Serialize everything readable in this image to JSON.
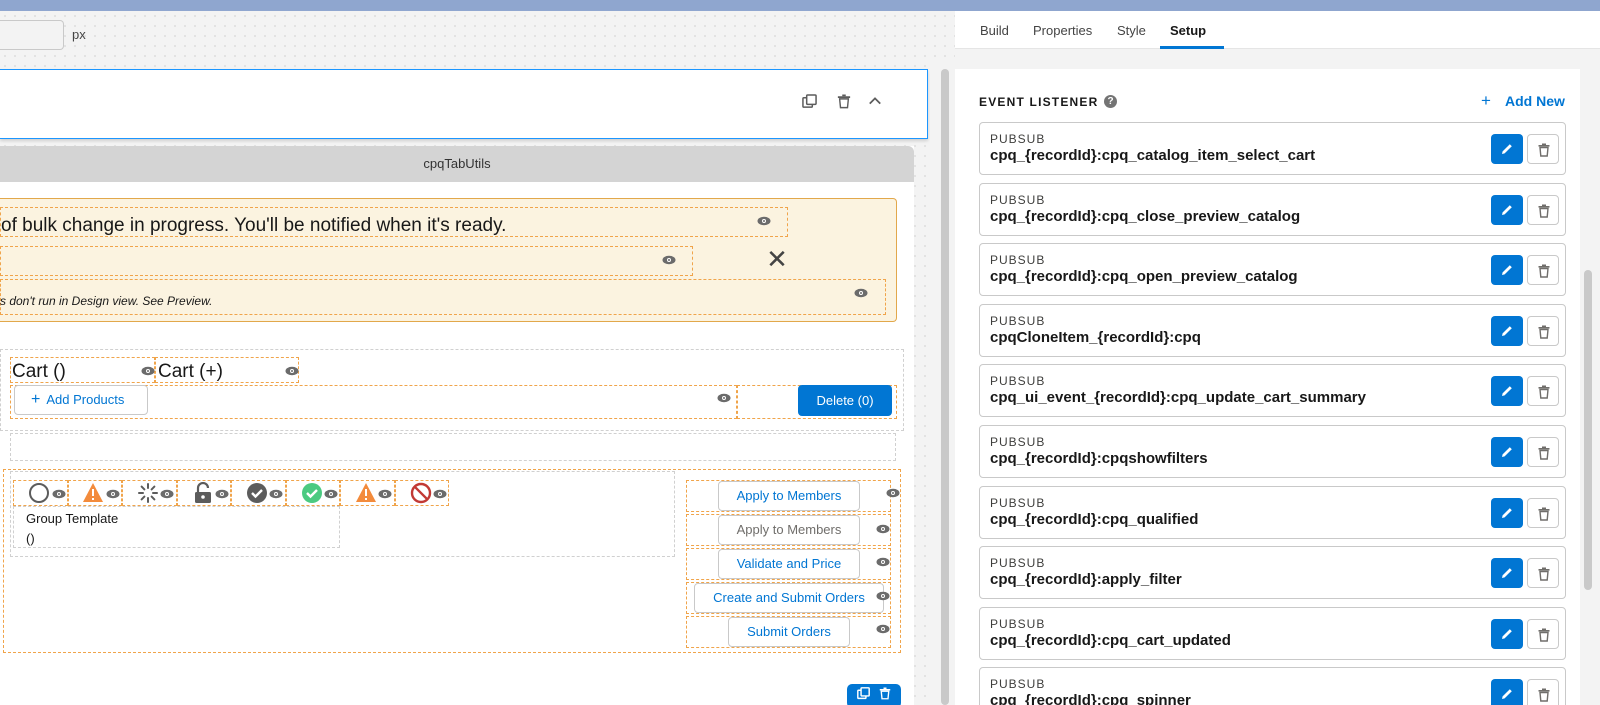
{
  "canvas": {
    "width_unit": "px",
    "tab_utils_label": "cpqTabUtils",
    "toast_message": "of bulk change in progress. You'll be notified when it's ready.",
    "toast_note": "s don't run in Design view. See Preview.",
    "cart_title_1": "Cart ()",
    "cart_title_2": "Cart (+)",
    "add_products_label": "Add Products",
    "delete_label": "Delete (0)",
    "group_template_label": "Group Template",
    "group_template_value": "()",
    "actions": [
      {
        "label": "Apply to Members",
        "disabled": false
      },
      {
        "label": "Apply to Members",
        "disabled": true
      },
      {
        "label": "Validate and Price",
        "disabled": false
      },
      {
        "label": "Create and Submit Orders",
        "disabled": false
      },
      {
        "label": "Submit Orders",
        "disabled": false
      }
    ]
  },
  "panel": {
    "tabs": [
      {
        "label": "Build"
      },
      {
        "label": "Properties"
      },
      {
        "label": "Style"
      },
      {
        "label": "Setup",
        "active": true
      }
    ],
    "event_listener_title": "EVENT LISTENER",
    "add_new_label": "Add New",
    "listeners": [
      {
        "type": "PUBSUB",
        "topic": "cpq_{recordId}:cpq_catalog_item_select_cart"
      },
      {
        "type": "PUBSUB",
        "topic": "cpq_{recordId}:cpq_close_preview_catalog"
      },
      {
        "type": "PUBSUB",
        "topic": "cpq_{recordId}:cpq_open_preview_catalog"
      },
      {
        "type": "PUBSUB",
        "topic": "cpqCloneItem_{recordId}:cpq"
      },
      {
        "type": "PUBSUB",
        "topic": "cpq_ui_event_{recordId}:cpq_update_cart_summary"
      },
      {
        "type": "PUBSUB",
        "topic": "cpq_{recordId}:cpqshowfilters"
      },
      {
        "type": "PUBSUB",
        "topic": "cpq_{recordId}:cpq_qualified"
      },
      {
        "type": "PUBSUB",
        "topic": "cpq_{recordId}:apply_filter"
      },
      {
        "type": "PUBSUB",
        "topic": "cpq_{recordId}:cpq_cart_updated"
      },
      {
        "type": "PUBSUB",
        "topic": "cpq_{recordId}:cpq_spinner"
      }
    ]
  },
  "colors": {
    "brand": "#0176d3",
    "warning_border": "#e2a84b",
    "warning_bg": "#fbf3e0",
    "success": "#4bca81",
    "error": "#c23934"
  },
  "icons": {
    "status": [
      "circle-outline-icon",
      "warning-icon",
      "spinner-icon",
      "lock-icon",
      "check-dark-icon",
      "check-green-icon",
      "warning-icon",
      "ban-icon"
    ]
  }
}
